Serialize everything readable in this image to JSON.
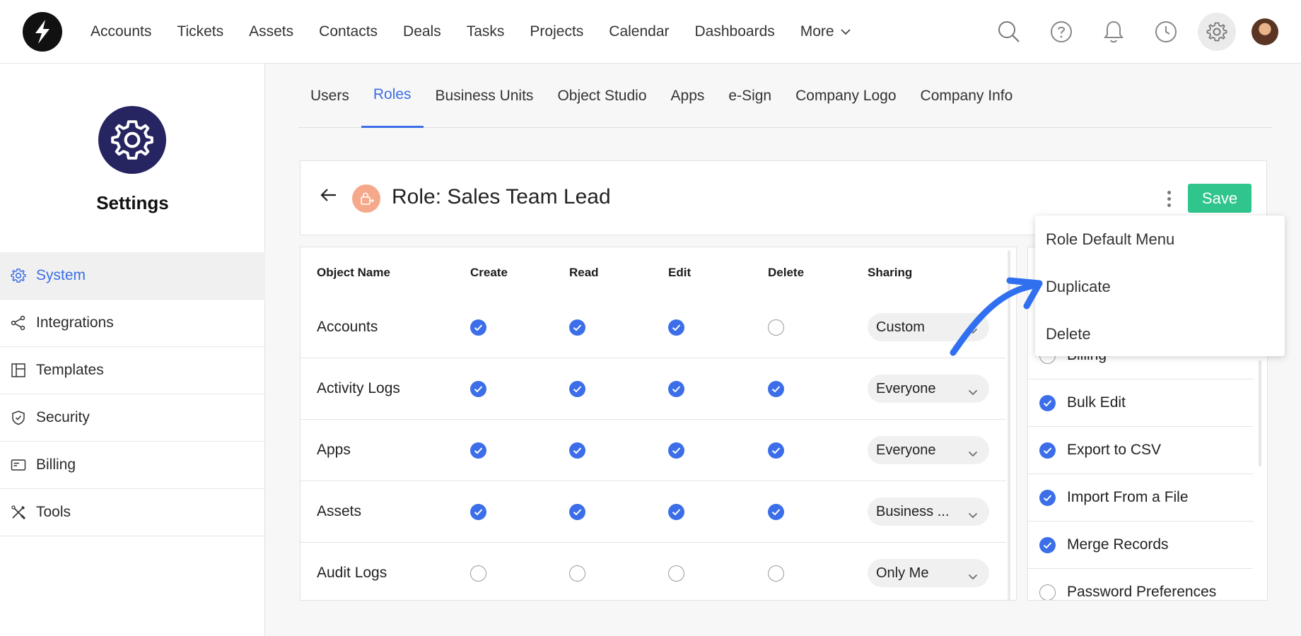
{
  "topnav": {
    "items": [
      "Accounts",
      "Tickets",
      "Assets",
      "Contacts",
      "Deals",
      "Tasks",
      "Projects",
      "Calendar",
      "Dashboards"
    ],
    "more_label": "More"
  },
  "sidebar": {
    "title": "Settings",
    "items": [
      {
        "label": "System",
        "icon": "gear-icon"
      },
      {
        "label": "Integrations",
        "icon": "share-icon"
      },
      {
        "label": "Templates",
        "icon": "layout-icon"
      },
      {
        "label": "Security",
        "icon": "shield-icon"
      },
      {
        "label": "Billing",
        "icon": "card-icon"
      },
      {
        "label": "Tools",
        "icon": "tools-icon"
      }
    ],
    "active_index": 0
  },
  "tabs": {
    "items": [
      "Users",
      "Roles",
      "Business Units",
      "Object Studio",
      "Apps",
      "e-Sign",
      "Company Logo",
      "Company Info"
    ],
    "active_index": 1
  },
  "role": {
    "title": "Role: Sales Team Lead",
    "save_label": "Save"
  },
  "table": {
    "headers": [
      "Object Name",
      "Create",
      "Read",
      "Edit",
      "Delete",
      "Sharing"
    ],
    "rows": [
      {
        "name": "Accounts",
        "create": true,
        "read": true,
        "edit": true,
        "delete": false,
        "sharing": "Custom"
      },
      {
        "name": "Activity Logs",
        "create": true,
        "read": true,
        "edit": true,
        "delete": true,
        "sharing": "Everyone"
      },
      {
        "name": "Apps",
        "create": true,
        "read": true,
        "edit": true,
        "delete": true,
        "sharing": "Everyone"
      },
      {
        "name": "Assets",
        "create": true,
        "read": true,
        "edit": true,
        "delete": true,
        "sharing": "Business ..."
      },
      {
        "name": "Audit Logs",
        "create": false,
        "read": false,
        "edit": false,
        "delete": false,
        "sharing": "Only Me"
      }
    ]
  },
  "permissions": {
    "items": [
      {
        "label": "Billing",
        "checked": false
      },
      {
        "label": "Bulk Edit",
        "checked": true
      },
      {
        "label": "Export to CSV",
        "checked": true
      },
      {
        "label": "Import From a File",
        "checked": true
      },
      {
        "label": "Merge Records",
        "checked": true
      },
      {
        "label": "Password Preferences",
        "checked": false
      }
    ]
  },
  "dropdown": {
    "items": [
      "Role Default Menu",
      "Duplicate",
      "Delete"
    ]
  },
  "colors": {
    "accent": "#3b6ee8",
    "save": "#2fc58c",
    "settings_avatar": "#262461",
    "role_icon": "#f5a98a",
    "annotation_arrow": "#2f6ff0"
  }
}
